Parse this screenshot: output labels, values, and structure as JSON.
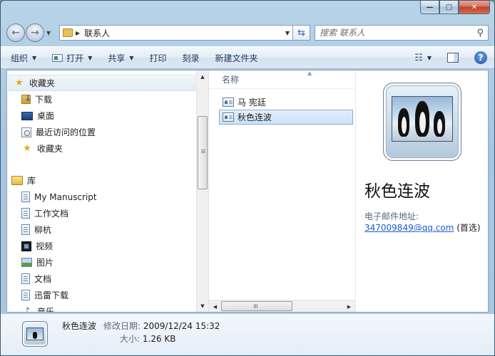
{
  "window": {
    "caption": {
      "minimize": "—",
      "maximize": "□",
      "close": "✕"
    }
  },
  "navigation": {
    "back_icon": "back-arrow-icon",
    "forward_icon": "forward-arrow-icon",
    "address_crumb": "联系人",
    "search_placeholder": "搜索 联系人"
  },
  "toolbar": {
    "organize": "组织",
    "open": "打开",
    "share": "共享",
    "print": "打印",
    "burn": "刻录",
    "new_folder": "新建文件夹"
  },
  "nav_pane": {
    "favorites": {
      "label": "收藏夹",
      "items": [
        {
          "label": "下载",
          "icon": "downloads-folder-icon"
        },
        {
          "label": "桌面",
          "icon": "desktop-icon"
        },
        {
          "label": "最近访问的位置",
          "icon": "recent-places-icon"
        },
        {
          "label": "收藏夹",
          "icon": "star-icon"
        }
      ]
    },
    "libraries": {
      "label": "库",
      "items": [
        {
          "label": "My Manuscript",
          "icon": "document-library-icon"
        },
        {
          "label": "工作文档",
          "icon": "document-library-icon"
        },
        {
          "label": "柳杭",
          "icon": "document-library-icon"
        },
        {
          "label": "视频",
          "icon": "video-library-icon"
        },
        {
          "label": "图片",
          "icon": "picture-library-icon"
        },
        {
          "label": "文档",
          "icon": "document-library-icon"
        },
        {
          "label": "迅雷下载",
          "icon": "document-library-icon"
        },
        {
          "label": "音乐",
          "icon": "music-library-icon"
        }
      ]
    }
  },
  "file_list": {
    "column_name": "名称",
    "items": [
      {
        "name": "马 宪廷",
        "selected": false
      },
      {
        "name": "秋色连波",
        "selected": true
      }
    ]
  },
  "preview": {
    "name": "秋色连波",
    "email_label": "电子邮件地址:",
    "email": "347009849@qq.com",
    "email_note": "(首选)"
  },
  "details": {
    "name": "秋色连波",
    "modified_label": "修改日期:",
    "modified_value": "2009/12/24 15:32",
    "size_label": "大小:",
    "size_value": "1.26 KB"
  }
}
